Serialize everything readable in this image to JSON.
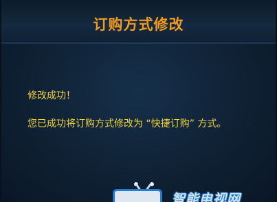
{
  "dialog": {
    "title": "订购方式修改",
    "message_line_1": "修改成功！",
    "message_line_2": "您已成功将订购方式修改为 “快捷订购” 方式。"
  },
  "watermark": {
    "text": "智能电视网",
    "icon": "tv-logo-icon"
  },
  "colors": {
    "title": "#f39a1f",
    "message": "#f1d43a",
    "background": "#0f2134"
  }
}
